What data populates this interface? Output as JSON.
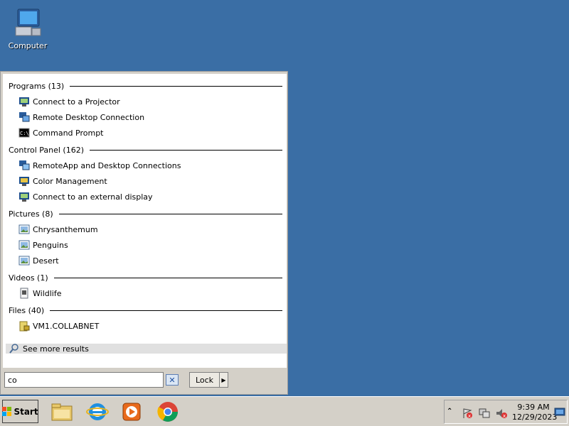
{
  "desktop": {
    "icons": [
      {
        "label": "Computer",
        "icon": "computer-icon"
      }
    ]
  },
  "start_menu": {
    "sections": [
      {
        "title": "Programs (13)",
        "items": [
          {
            "label": "Connect to a Projector",
            "icon": "projector-icon"
          },
          {
            "label": "Remote Desktop Connection",
            "icon": "remote-desktop-icon"
          },
          {
            "label": "Command Prompt",
            "icon": "command-prompt-icon"
          }
        ]
      },
      {
        "title": "Control Panel (162)",
        "items": [
          {
            "label": "RemoteApp and Desktop Connections",
            "icon": "remoteapp-icon"
          },
          {
            "label": "Color Management",
            "icon": "color-management-icon"
          },
          {
            "label": "Connect to an external display",
            "icon": "external-display-icon"
          }
        ]
      },
      {
        "title": "Pictures (8)",
        "items": [
          {
            "label": "Chrysanthemum",
            "icon": "picture-icon"
          },
          {
            "label": "Penguins",
            "icon": "picture-icon"
          },
          {
            "label": "Desert",
            "icon": "picture-icon"
          }
        ]
      },
      {
        "title": "Videos (1)",
        "items": [
          {
            "label": "Wildlife",
            "icon": "video-icon"
          }
        ]
      },
      {
        "title": "Files (40)",
        "items": [
          {
            "label": "VM1.COLLABNET",
            "icon": "lock-file-icon"
          }
        ]
      }
    ],
    "see_more": "See more results",
    "search_value": "co",
    "lock_label": "Lock"
  },
  "taskbar": {
    "start_label": "Start",
    "apps": [
      "file-explorer-icon",
      "internet-explorer-icon",
      "media-player-icon",
      "chrome-icon"
    ],
    "tray_icons": [
      "show-hidden-icon",
      "action-center-icon",
      "network-icon",
      "volume-muted-icon"
    ],
    "time": "9:39 AM",
    "date": "12/29/2023"
  },
  "colors": {
    "desktop": "#3a6ea5",
    "panel": "#d4d0c8"
  }
}
